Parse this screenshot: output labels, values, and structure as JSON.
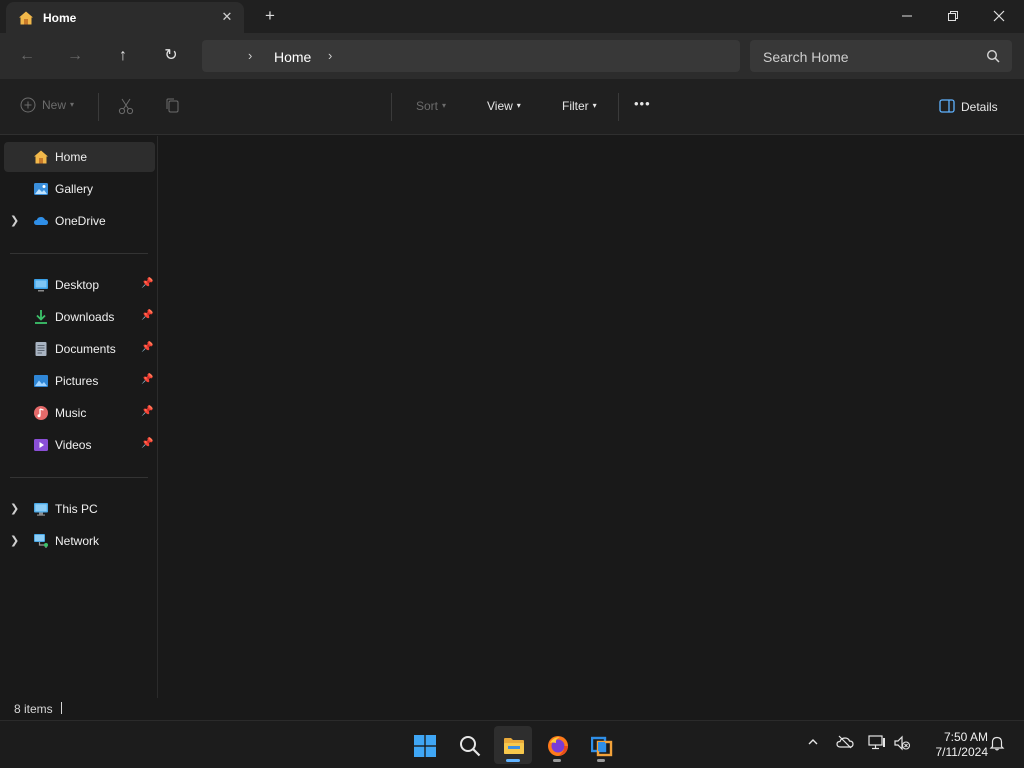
{
  "window": {
    "tab_title": "Home",
    "tab_close_icon": "close-icon",
    "new_tab_icon": "plus-icon",
    "controls": [
      "minimize-icon",
      "restore-icon",
      "close-icon"
    ]
  },
  "navigation": {
    "back_icon": "arrow-left-icon",
    "forward_icon": "arrow-right-icon",
    "up_icon": "arrow-up-icon",
    "refresh_icon": "refresh-icon",
    "breadcrumb": [
      "Home"
    ],
    "search_placeholder": "Search Home"
  },
  "command_bar": {
    "new_label": "New",
    "sort_label": "Sort",
    "view_label": "View",
    "filter_label": "Filter",
    "more_label": "•••",
    "details_label": "Details"
  },
  "sidebar": {
    "top_items": [
      {
        "label": "Home",
        "icon": "home-icon",
        "selected": true,
        "expandable": false
      },
      {
        "label": "Gallery",
        "icon": "gallery-icon",
        "selected": false,
        "expandable": false
      },
      {
        "label": "OneDrive",
        "icon": "onedrive-cloud-icon",
        "selected": false,
        "expandable": true
      }
    ],
    "pinned_items": [
      {
        "label": "Desktop",
        "icon": "desktop-icon",
        "pinned": true
      },
      {
        "label": "Downloads",
        "icon": "downloads-icon",
        "pinned": true
      },
      {
        "label": "Documents",
        "icon": "documents-icon",
        "pinned": true
      },
      {
        "label": "Pictures",
        "icon": "pictures-icon",
        "pinned": true
      },
      {
        "label": "Music",
        "icon": "music-icon",
        "pinned": true
      },
      {
        "label": "Videos",
        "icon": "videos-icon",
        "pinned": true
      }
    ],
    "bottom_items": [
      {
        "label": "This PC",
        "icon": "this-pc-icon",
        "expandable": true
      },
      {
        "label": "Network",
        "icon": "network-icon",
        "expandable": true
      }
    ]
  },
  "status_bar": {
    "item_count": "8 items"
  },
  "taskbar": {
    "apps": [
      {
        "name": "start-button",
        "icon": "windows-logo-icon",
        "active": false
      },
      {
        "name": "search-button",
        "icon": "search-icon",
        "active": false
      },
      {
        "name": "file-explorer",
        "icon": "folder-icon",
        "active": true
      },
      {
        "name": "firefox",
        "icon": "firefox-icon",
        "active": false
      },
      {
        "name": "virtualbox",
        "icon": "virtualbox-icon",
        "active": false
      }
    ],
    "tray_icons": [
      "chevron-up-icon",
      "onedrive-offline-icon",
      "network-icon",
      "volume-muted-icon"
    ],
    "time": "7:50 AM",
    "date": "7/11/2024",
    "notification_icon": "bell-icon"
  },
  "colors": {
    "accent": "#5fb2ff",
    "window_bg": "#191919",
    "toolbar_bg": "#2c2c2c",
    "selected_item": "#2d2d2d"
  }
}
